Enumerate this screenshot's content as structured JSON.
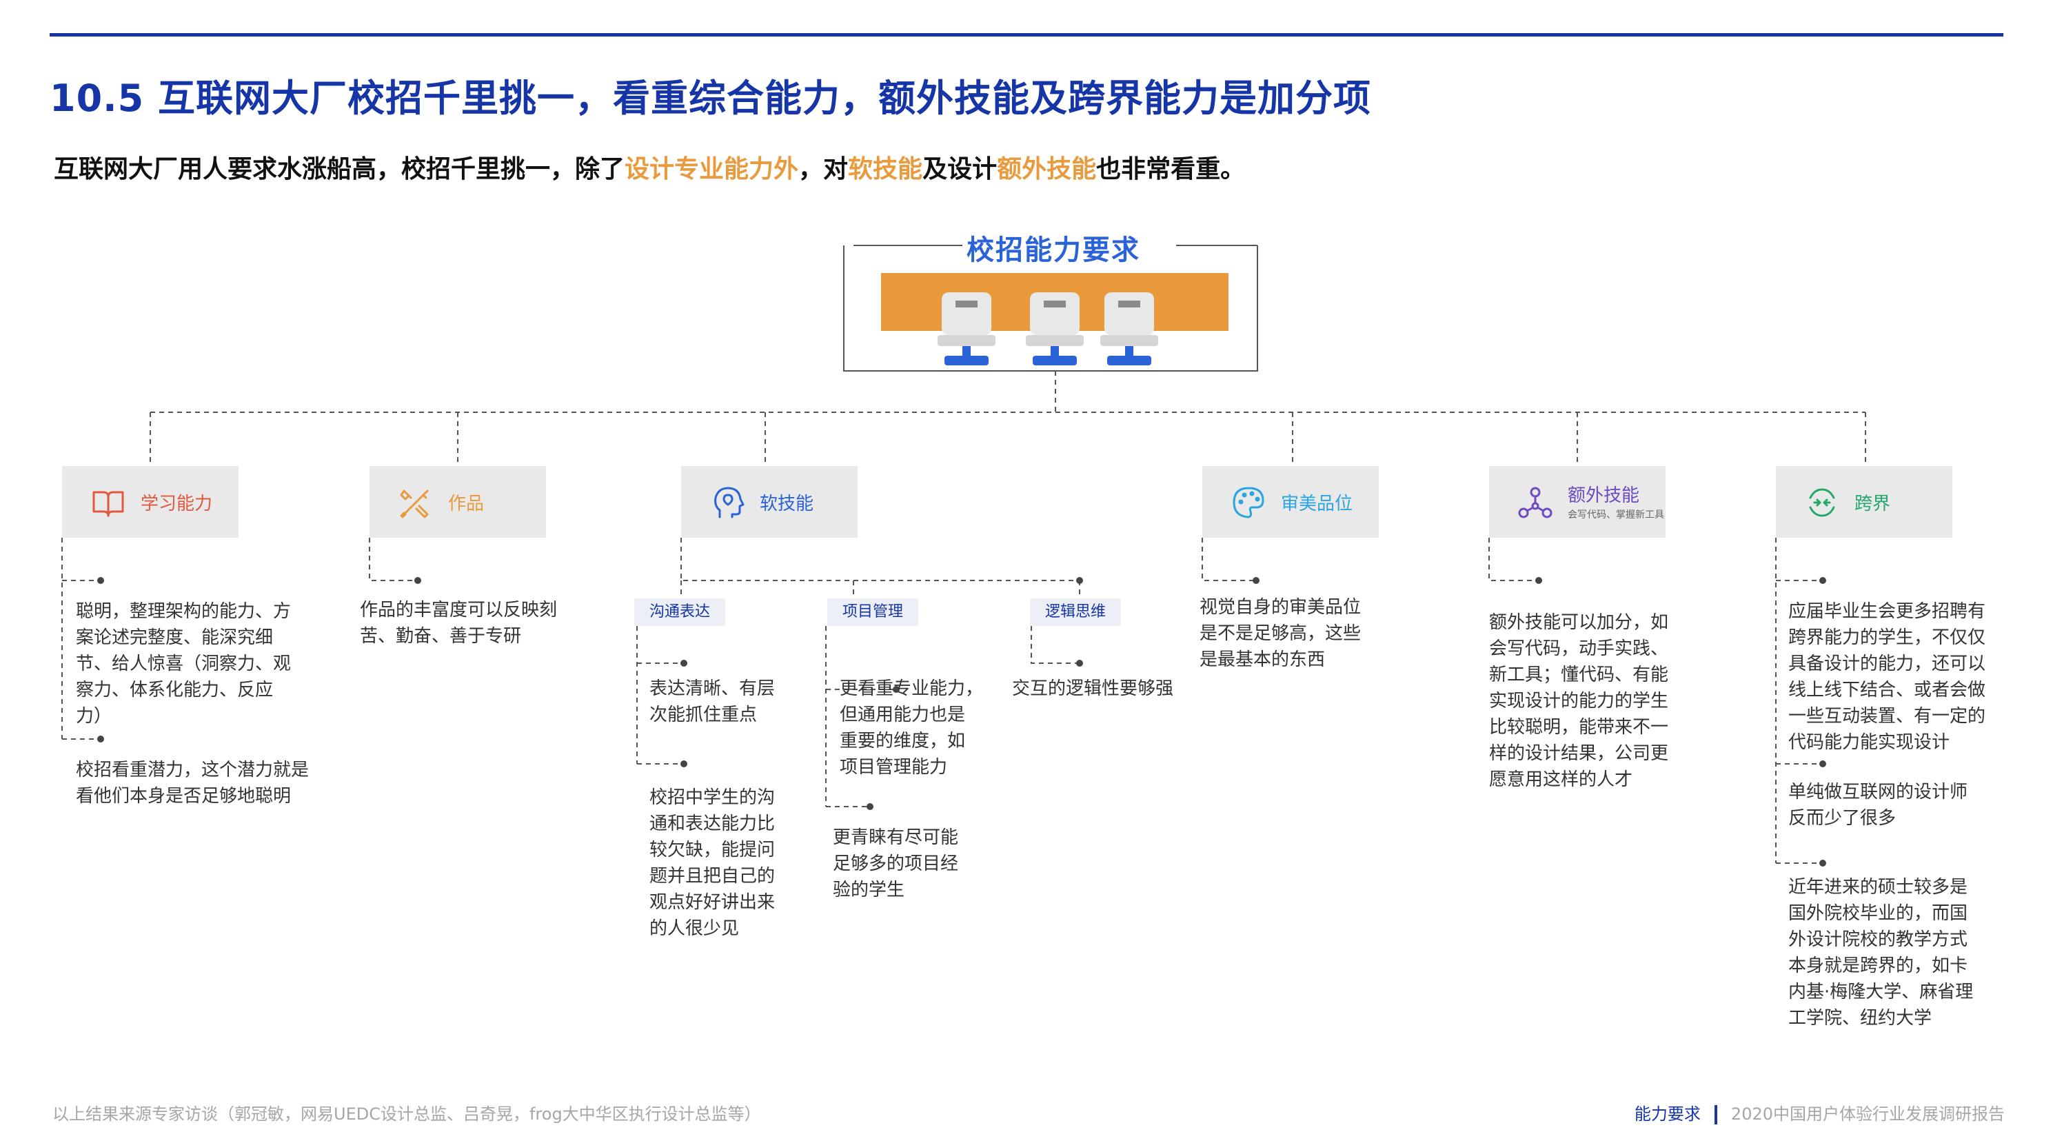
{
  "page": {
    "title": "10.5 互联网大厂校招千里挑一，看重综合能力，额外技能及跨界能力是加分项",
    "intro": {
      "p1": "互联网大厂用人要求水涨船高，校招千里挑一，除了",
      "h1": "设计专业能力外",
      "p2": "，对",
      "h2": "软技能",
      "p3": "及设计",
      "h3": "额外技能",
      "p4": "也非常看重。"
    }
  },
  "center": {
    "title": "校招能力要求"
  },
  "cards": [
    {
      "label": "学习能力",
      "icon": "book-icon",
      "color": "#e2583e"
    },
    {
      "label": "作品",
      "icon": "tools-icon",
      "color": "#e89a3c"
    },
    {
      "label": "软技能",
      "icon": "head-icon",
      "color": "#2a63d8"
    },
    {
      "label": "审美品位",
      "icon": "palette-icon",
      "color": "#2aa5e0"
    },
    {
      "label": "额外技能",
      "sublabel": "会写代码、掌握新工具",
      "icon": "network-icon",
      "color": "#6e4bc2"
    },
    {
      "label": "跨界",
      "icon": "cross-arrows-icon",
      "color": "#22a86a"
    }
  ],
  "soft": {
    "tags": [
      "沟通表达",
      "项目管理",
      "逻辑思维"
    ]
  },
  "texts": {
    "learn1": [
      "聪明，整理架构的能力、方",
      "案论述完整度、能深究细",
      "节、给人惊喜（洞察力、观",
      "察力、体系化能力、反应",
      "力）"
    ],
    "learn2": [
      "校招看重潜力，这个潜力就是",
      "看他们本身是否足够地聪明"
    ],
    "work1": [
      "作品的丰富度可以反映刻",
      "苦、勤奋、善于专研"
    ],
    "comm1": [
      "表达清晰、有层",
      "次能抓住重点"
    ],
    "comm2": [
      "校招中学生的沟",
      "通和表达能力比",
      "较欠缺，能提问",
      "题并且把自己的",
      "观点好好讲出来",
      "的人很少见"
    ],
    "proj1": [
      "更看重专业能力，",
      "但通用能力也是",
      "重要的维度，如",
      "项目管理能力"
    ],
    "proj2": [
      "更青睐有尽可能",
      "足够多的项目经",
      "验的学生"
    ],
    "logic1": [
      "交互的逻辑性要够强"
    ],
    "aes1": [
      "视觉自身的审美品位",
      "是不是足够高，这些",
      "是最基本的东西"
    ],
    "extra1": [
      "额外技能可以加分，如",
      "会写代码，动手实践、",
      "新工具；懂代码、有能",
      "实现设计的能力的学生",
      "比较聪明，能带来不一",
      "样的设计结果，公司更",
      "愿意用这样的人才"
    ],
    "cross1": [
      "应届毕业生会更多招聘有",
      "跨界能力的学生，不仅仅",
      "具备设计的能力，还可以",
      "线上线下结合、或者会做",
      "一些互动装置、有一定的",
      "代码能力能实现设计"
    ],
    "cross2": [
      "单纯做互联网的设计师",
      "反而少了很多"
    ],
    "cross3": [
      "近年进来的硕士较多是",
      "国外院校毕业的，而国",
      "外设计院校的教学方式",
      "本身就是跨界的，如卡",
      "内基·梅隆大学、麻省理",
      "工学院、纽约大学"
    ]
  },
  "footer": {
    "source": "以上结果来源专家访谈（郭冠敏，网易UEDC设计总监、吕奇晃，frog大中华区执行设计总监等）",
    "section": "能力要求",
    "report": "2020中国用户体验行业发展调研报告"
  },
  "colors": {
    "brand_blue": "#1636a8",
    "accent_orange": "#e89a3c",
    "title_blue": "#2a63d8"
  }
}
